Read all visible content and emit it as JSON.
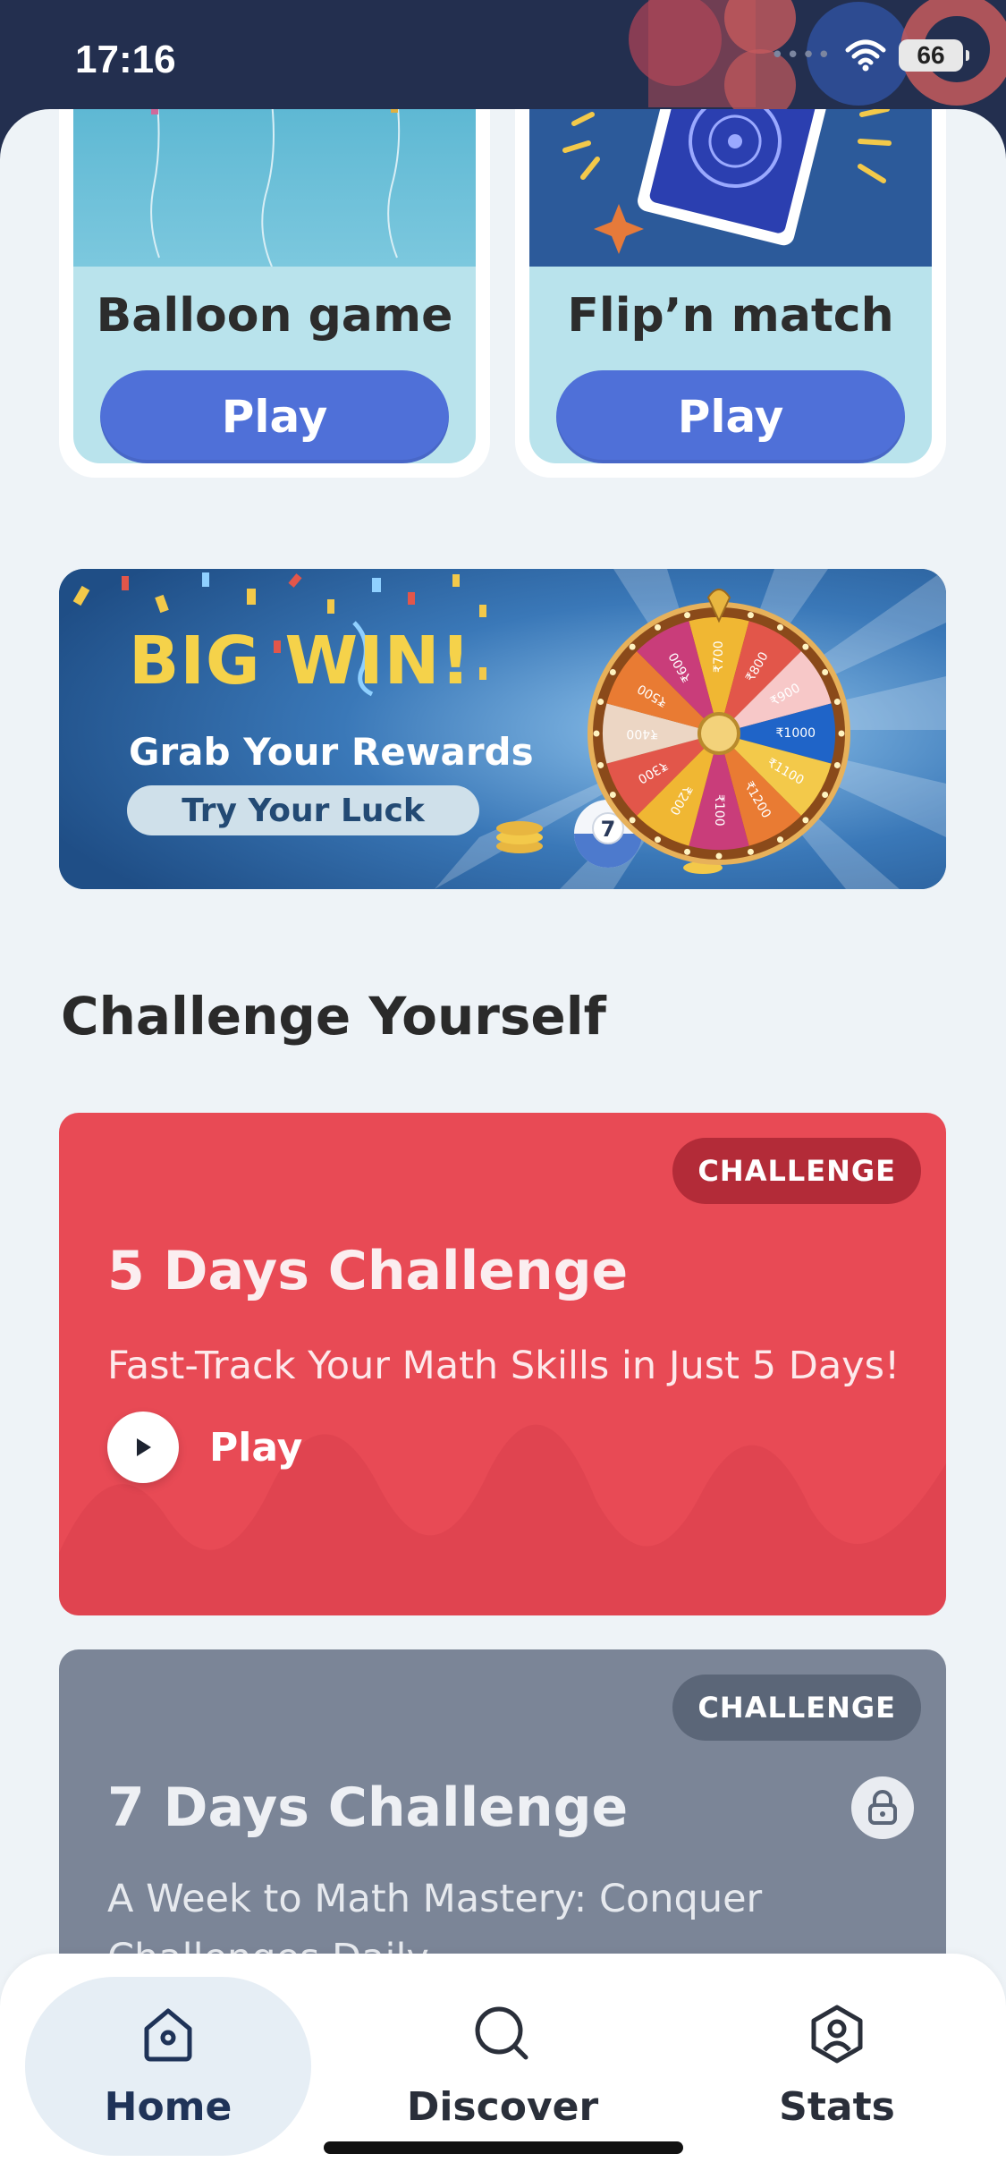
{
  "status_bar": {
    "time": "17:16",
    "battery": "66"
  },
  "games": [
    {
      "title": "Balloon game",
      "play_label": "Play"
    },
    {
      "title": "Flip’n match",
      "play_label": "Play"
    }
  ],
  "banner": {
    "headline": "BIG WIN!",
    "subtitle": "Grab Your Rewards",
    "button_label": "Try Your Luck",
    "wheel_values": [
      "₹700",
      "₹800",
      "₹900",
      "₹1000",
      "₹1100",
      "₹1200",
      "₹100",
      "₹200",
      "₹300",
      "₹400",
      "₹500",
      "₹600"
    ],
    "ball_number": "7"
  },
  "section": {
    "title": "Challenge Yourself"
  },
  "challenges": [
    {
      "badge": "CHALLENGE",
      "title": "5 Days Challenge",
      "subtitle": "Fast-Track Your Math Skills in Just 5 Days!",
      "play_label": "Play",
      "color": "#e84a55"
    },
    {
      "badge": "CHALLENGE",
      "title": "7 Days Challenge",
      "subtitle": "A Week to Math Mastery: Conquer Challenges Daily",
      "locked": true,
      "color": "#7b8597"
    }
  ],
  "tabbar": {
    "tabs": [
      {
        "label": "Home",
        "icon": "home-icon",
        "active": true
      },
      {
        "label": "Discover",
        "icon": "search-icon",
        "active": false
      },
      {
        "label": "Stats",
        "icon": "profile-icon",
        "active": false
      }
    ]
  },
  "colors": {
    "accent": "#4f70d8",
    "status_bar": "#232f4f",
    "background": "#eef3f7"
  }
}
